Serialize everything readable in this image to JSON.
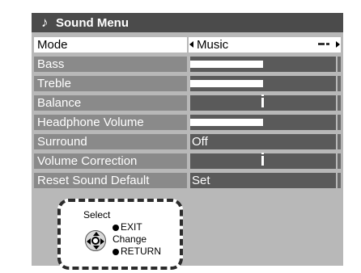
{
  "menu": {
    "title": "Sound Menu",
    "title_icon": "music-note-icon",
    "rows": [
      {
        "label": "Mode",
        "value": "Music",
        "type": "select",
        "selected": true
      },
      {
        "label": "Bass",
        "value": "",
        "type": "slider",
        "level": 0.5
      },
      {
        "label": "Treble",
        "value": "",
        "type": "slider",
        "level": 0.5
      },
      {
        "label": "Balance",
        "value": "",
        "type": "center",
        "level": 0.5
      },
      {
        "label": "Headphone Volume",
        "value": "",
        "type": "slider",
        "level": 0.5
      },
      {
        "label": "Surround",
        "value": "Off",
        "type": "text"
      },
      {
        "label": "Volume Correction",
        "value": "",
        "type": "center",
        "level": 0.5
      },
      {
        "label": "Reset Sound Default",
        "value": "Set",
        "type": "text"
      }
    ]
  },
  "guide": {
    "select": "Select",
    "exit": "EXIT",
    "change": "Change",
    "return": "RETURN"
  },
  "colors": {
    "panel": "#b8b8b8",
    "header": "#4b4b4b",
    "label_bg": "#8a8a8a",
    "value_bg": "#5a5a5a",
    "selected_bg": "#ffffff"
  }
}
